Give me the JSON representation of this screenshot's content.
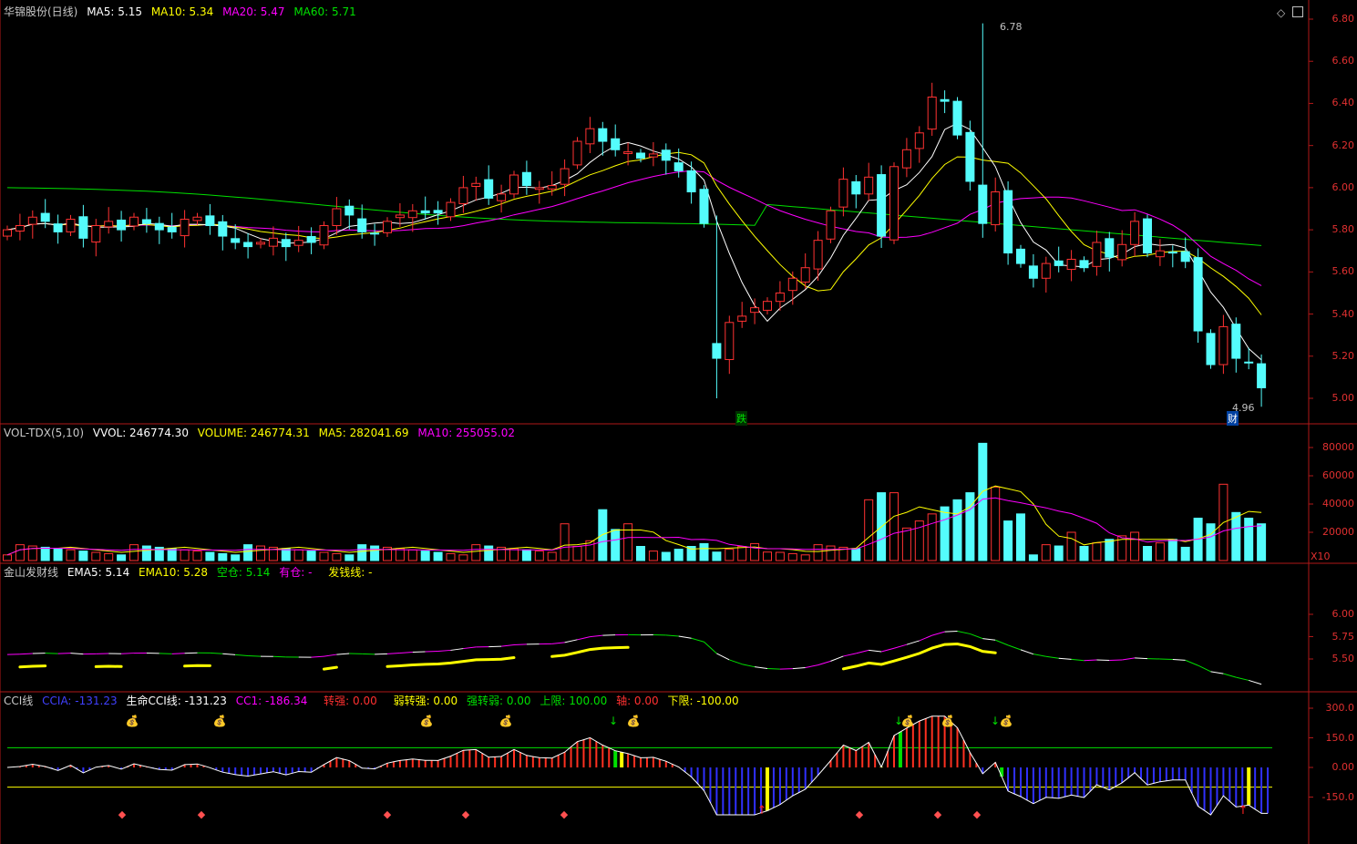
{
  "main": {
    "header": {
      "title": "华锦股份(日线)",
      "ma5": "MA5: 5.15",
      "ma10": "MA10: 5.34",
      "ma20": "MA20: 5.47",
      "ma60": "MA60: 5.71"
    },
    "y_ticks": [
      "6.80",
      "6.60",
      "6.40",
      "6.20",
      "6.00",
      "5.80",
      "5.60",
      "5.40",
      "5.20",
      "5.00"
    ],
    "y_range": [
      4.9,
      6.85
    ],
    "high_label": "6.78",
    "low_label": "4.96",
    "marker_die": "跌",
    "marker_cai": "财"
  },
  "volume": {
    "header": {
      "name": "VOL-TDX(5,10)",
      "vvol": "VVOL: 246774.30",
      "volume": "VOLUME: 246774.31",
      "ma5": "MA5: 282041.69",
      "ma10": "MA10: 255055.02"
    },
    "y_ticks": [
      "80000",
      "60000",
      "40000",
      "20000"
    ],
    "unit": "X10"
  },
  "jinshan": {
    "header": {
      "name": "金山发财线",
      "ema5": "EMA5: 5.14",
      "ema10": "EMA10: 5.28",
      "kongcang": "空仓: 5.14",
      "youcang": "有仓: -",
      "faqian": "发钱线: -"
    },
    "y_ticks": [
      "6.00",
      "5.75",
      "5.50"
    ]
  },
  "cci": {
    "header": {
      "name": "CCI线",
      "ccia": "CCIA: -131.23",
      "life": "生命CCI线: -131.23",
      "cc1": "CC1: -186.34",
      "zhuanqiang": "转强: 0.00",
      "ruozhuanqiang": "弱转强: 0.00",
      "qiangzhuanruo": "强转弱: 0.00",
      "upper": "上限: 100.00",
      "axis": "轴: 0.00",
      "lower": "下限: -100.00"
    },
    "y_ticks": [
      "300.0",
      "150.0",
      "0.00",
      "-150.0"
    ]
  },
  "colors": {
    "up": "#ff3232",
    "down": "#54fcfc",
    "ma5": "#ffffff",
    "ma10": "#ffff00",
    "ma20": "#ff00ff",
    "ma60": "#00e000",
    "axis": "#b01818",
    "label": "#e03030"
  },
  "icons": {
    "toolbar": [
      "diamond-icon",
      "window-icon"
    ],
    "signals": [
      "money-bag-icon",
      "gem-icon",
      "arrow-up-icon",
      "arrow-down-icon"
    ]
  },
  "chart_data": {
    "type": "candlestick",
    "title": "华锦股份(日线)",
    "x_count": 100,
    "ohlc_close_approx": [
      5.8,
      5.82,
      5.86,
      5.84,
      5.79,
      5.85,
      5.76,
      5.82,
      5.84,
      5.8,
      5.86,
      5.83,
      5.8,
      5.79,
      5.85,
      5.86,
      5.82,
      5.77,
      5.74,
      5.72,
      5.74,
      5.76,
      5.72,
      5.75,
      5.74,
      5.82,
      5.9,
      5.87,
      5.79,
      5.78,
      5.84,
      5.87,
      5.89,
      5.88,
      5.88,
      5.93,
      6.0,
      6.02,
      5.95,
      5.97,
      6.06,
      6.01,
      6.0,
      6.01,
      6.09,
      6.22,
      6.28,
      6.22,
      6.18,
      6.17,
      6.14,
      6.16,
      6.13,
      6.08,
      5.98,
      5.83,
      5.19,
      5.36,
      5.39,
      5.43,
      5.46,
      5.5,
      5.57,
      5.62,
      5.75,
      5.89,
      6.04,
      5.97,
      6.05,
      5.77,
      6.1,
      6.18,
      6.26,
      6.43,
      6.41,
      6.25,
      6.03,
      5.83,
      5.98,
      5.69,
      5.64,
      5.57,
      5.64,
      5.63,
      5.66,
      5.62,
      5.74,
      5.67,
      5.73,
      5.84,
      5.69,
      5.7,
      5.69,
      5.65,
      5.32,
      5.16,
      5.34,
      5.19,
      5.17,
      5.05
    ],
    "high": 6.78,
    "low": 4.96,
    "ma_values": {
      "MA5": 5.15,
      "MA10": 5.34,
      "MA20": 5.47,
      "MA60": 5.71
    },
    "volume_ma": {
      "MA5": 282041.69,
      "MA10": 255055.02
    },
    "cci_levels": {
      "upper": 100.0,
      "axis": 0.0,
      "lower": -100.0
    }
  }
}
